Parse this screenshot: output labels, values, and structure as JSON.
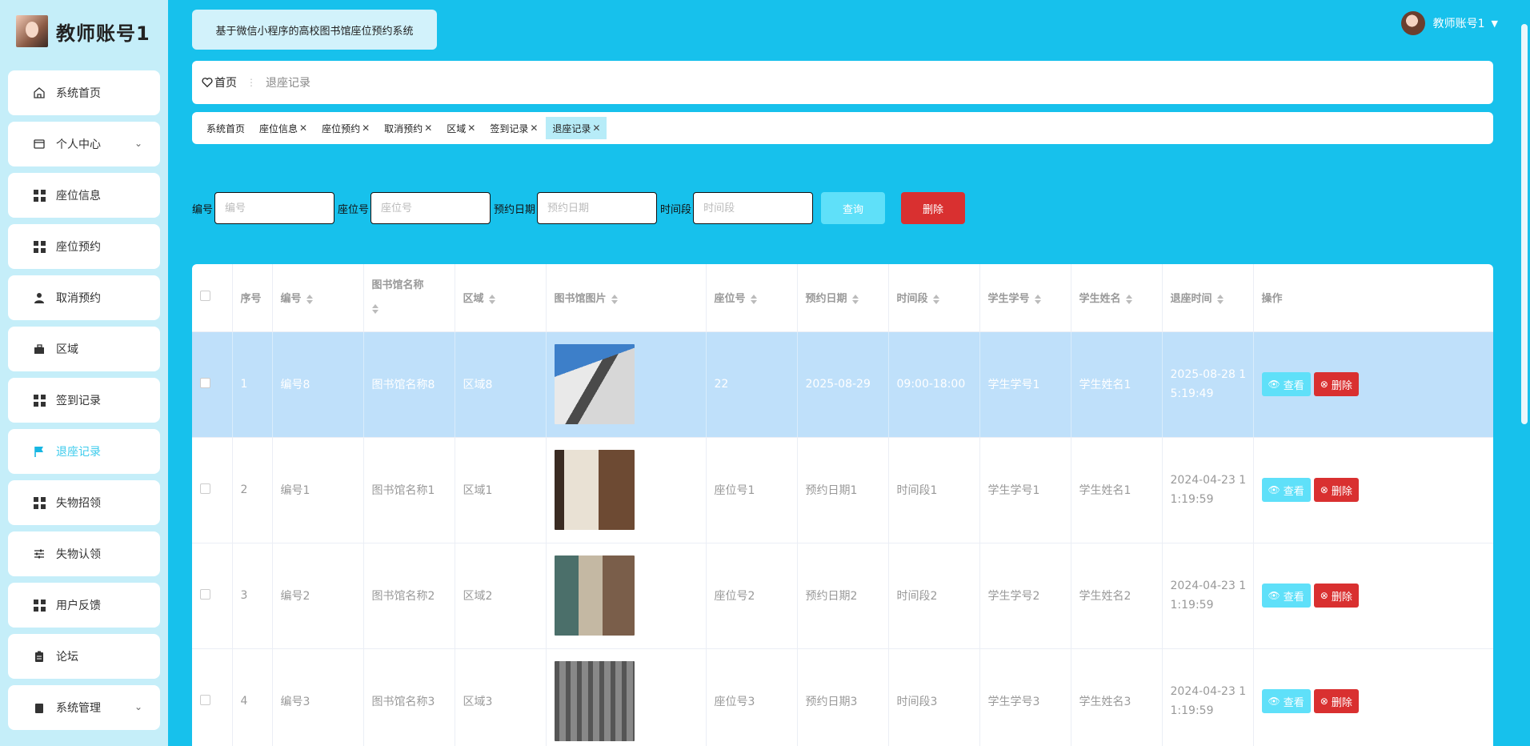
{
  "brand": {
    "title": "教师账号1"
  },
  "sidebar": {
    "items": [
      {
        "label": "系统首页",
        "icon": "home-icon"
      },
      {
        "label": "个人中心",
        "icon": "wallet-icon",
        "has_children": true
      },
      {
        "label": "座位信息",
        "icon": "grid-icon"
      },
      {
        "label": "座位预约",
        "icon": "grid-icon"
      },
      {
        "label": "取消预约",
        "icon": "user-icon"
      },
      {
        "label": "区域",
        "icon": "briefcase-icon"
      },
      {
        "label": "签到记录",
        "icon": "grid-icon"
      },
      {
        "label": "退座记录",
        "icon": "flag-icon",
        "active": true
      },
      {
        "label": "失物招领",
        "icon": "grid-icon"
      },
      {
        "label": "失物认领",
        "icon": "sliders-icon"
      },
      {
        "label": "用户反馈",
        "icon": "grid-icon"
      },
      {
        "label": "论坛",
        "icon": "clipboard-icon"
      },
      {
        "label": "系统管理",
        "icon": "clipboard-icon",
        "has_children": true
      }
    ]
  },
  "header": {
    "system_title": "基于微信小程序的高校图书馆座位预约系统",
    "user_name": "教师账号1"
  },
  "breadcrumb": {
    "home": "首页",
    "separator": "⋮",
    "current": "退座记录"
  },
  "tags": [
    {
      "label": "系统首页",
      "closable": false
    },
    {
      "label": "座位信息",
      "closable": true
    },
    {
      "label": "座位预约",
      "closable": true
    },
    {
      "label": "取消预约",
      "closable": true
    },
    {
      "label": "区域",
      "closable": true
    },
    {
      "label": "签到记录",
      "closable": true
    },
    {
      "label": "退座记录",
      "closable": true,
      "active": true
    }
  ],
  "search": {
    "fields": [
      {
        "label": "编号",
        "placeholder": "编号",
        "value": ""
      },
      {
        "label": "座位号",
        "placeholder": "座位号",
        "value": ""
      },
      {
        "label": "预约日期",
        "placeholder": "预约日期",
        "value": ""
      },
      {
        "label": "时间段",
        "placeholder": "时间段",
        "value": ""
      }
    ],
    "query_label": "查询",
    "delete_label": "删除"
  },
  "table": {
    "columns": [
      "序号",
      "编号",
      "图书馆名称",
      "区域",
      "图书馆图片",
      "座位号",
      "预约日期",
      "时间段",
      "学生学号",
      "学生姓名",
      "退座时间",
      "操作"
    ],
    "view_label": "查看",
    "delete_label": "删除",
    "rows": [
      {
        "index": "1",
        "code": "编号8",
        "library": "图书馆名称8",
        "area": "区域8",
        "seat": "22",
        "date": "2025-08-29",
        "period": "09:00-18:00",
        "student_no": "学生学号1",
        "student_name": "学生姓名1",
        "return_time": "2025-08-28 15:19:49",
        "selected": true
      },
      {
        "index": "2",
        "code": "编号1",
        "library": "图书馆名称1",
        "area": "区域1",
        "seat": "座位号1",
        "date": "预约日期1",
        "period": "时间段1",
        "student_no": "学生学号1",
        "student_name": "学生姓名1",
        "return_time": "2024-04-23 11:19:59"
      },
      {
        "index": "3",
        "code": "编号2",
        "library": "图书馆名称2",
        "area": "区域2",
        "seat": "座位号2",
        "date": "预约日期2",
        "period": "时间段2",
        "student_no": "学生学号2",
        "student_name": "学生姓名2",
        "return_time": "2024-04-23 11:19:59"
      },
      {
        "index": "4",
        "code": "编号3",
        "library": "图书馆名称3",
        "area": "区域3",
        "seat": "座位号3",
        "date": "预约日期3",
        "period": "时间段3",
        "student_no": "学生学号3",
        "student_name": "学生姓名3",
        "return_time": "2024-04-23 11:19:59"
      }
    ]
  },
  "colors": {
    "accent": "#17c1ec",
    "danger": "#d93030",
    "info": "#5fe0f9",
    "selected_row": "#bfe0fa"
  }
}
